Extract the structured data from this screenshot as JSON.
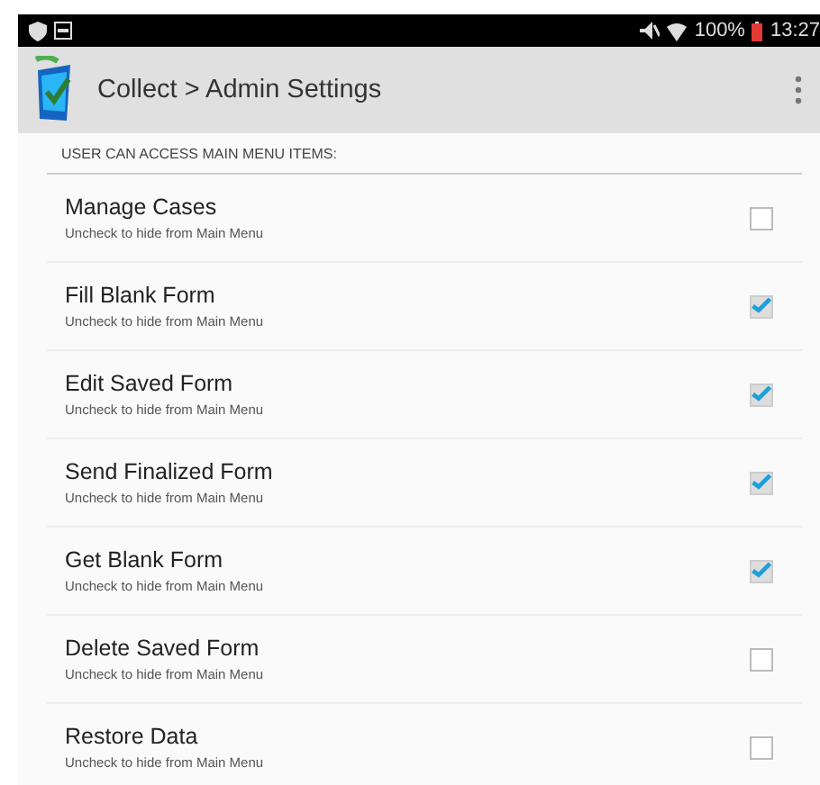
{
  "status_bar": {
    "battery": "100%",
    "time": "13:27"
  },
  "app_bar": {
    "title": "Collect > Admin Settings"
  },
  "category": "USER CAN ACCESS MAIN MENU ITEMS:",
  "items": [
    {
      "title": "Manage Cases",
      "summary": "Uncheck to hide from Main Menu",
      "checked": false
    },
    {
      "title": "Fill Blank Form",
      "summary": "Uncheck to hide from Main Menu",
      "checked": true
    },
    {
      "title": "Edit Saved Form",
      "summary": "Uncheck to hide from Main Menu",
      "checked": true
    },
    {
      "title": "Send Finalized Form",
      "summary": "Uncheck to hide from Main Menu",
      "checked": true
    },
    {
      "title": "Get Blank Form",
      "summary": "Uncheck to hide from Main Menu",
      "checked": true
    },
    {
      "title": "Delete Saved Form",
      "summary": "Uncheck to hide from Main Menu",
      "checked": false
    },
    {
      "title": "Restore Data",
      "summary": "Uncheck to hide from Main Menu",
      "checked": false
    }
  ]
}
